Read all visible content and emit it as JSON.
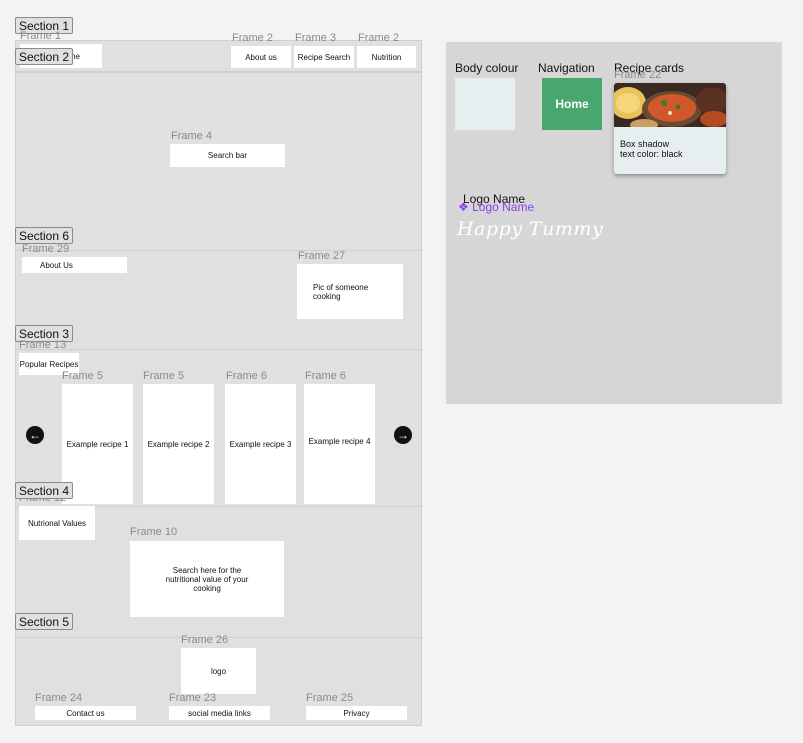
{
  "sections": {
    "s1": "Section 1",
    "s2": "Section 2",
    "s6": "Section 6",
    "s3": "Section 3",
    "s4": "Section 4",
    "s5": "Section 5"
  },
  "header": {
    "frame1_label": "Frame 1",
    "frame1_text": "me",
    "nav": [
      {
        "frame": "Frame 2",
        "label": "About us"
      },
      {
        "frame": "Frame 3",
        "label": "Recipe Search"
      },
      {
        "frame": "Frame 2",
        "label": "Nutrition"
      }
    ]
  },
  "hero": {
    "frame_label": "Frame 4",
    "search_label": "Search bar"
  },
  "about": {
    "frame29_label": "Frame 29",
    "about_text": "About Us",
    "frame27_label": "Frame 27",
    "pic_text": "Pic of someone cooking"
  },
  "popular": {
    "frame13_label": "Frame 13",
    "title": "Popular Recipes",
    "cards": [
      {
        "frame": "Frame 5",
        "label": "Example recipe 1"
      },
      {
        "frame": "Frame 5",
        "label": "Example recipe 2"
      },
      {
        "frame": "Frame 6",
        "label": "Example recipe 3"
      },
      {
        "frame": "Frame 6",
        "label": "Example recipe 4"
      }
    ],
    "prev_icon": "←",
    "next_icon": "→"
  },
  "nutrition": {
    "frame12_label": "Frame 12",
    "title": "Nutrional Values",
    "frame10_label": "Frame 10",
    "search_text": "Search here for the nutritional value of your cooking"
  },
  "footer": {
    "frame26_label": "Frame 26",
    "logo_text": "logo",
    "links": [
      {
        "frame": "Frame 24",
        "label": "Contact us"
      },
      {
        "frame": "Frame 23",
        "label": "social media links"
      },
      {
        "frame": "Frame 25",
        "label": "Privacy"
      }
    ]
  },
  "style_guide": {
    "body_colour_title": "Body colour",
    "body_colour": "#e6eef0",
    "navigation_title": "Navigation",
    "nav_button_label": "Home",
    "nav_button_color": "#4aa66f",
    "recipe_cards_title": "Recipe cards",
    "frame22_label": "Frame 22",
    "card_text_line1": "Box shadow",
    "card_text_line2": "text color: black",
    "logo_name_title": "Logo Name",
    "component_label": "Logo Name",
    "component_color": "#8a3ff0",
    "logo_script": "Happy Tummy"
  }
}
